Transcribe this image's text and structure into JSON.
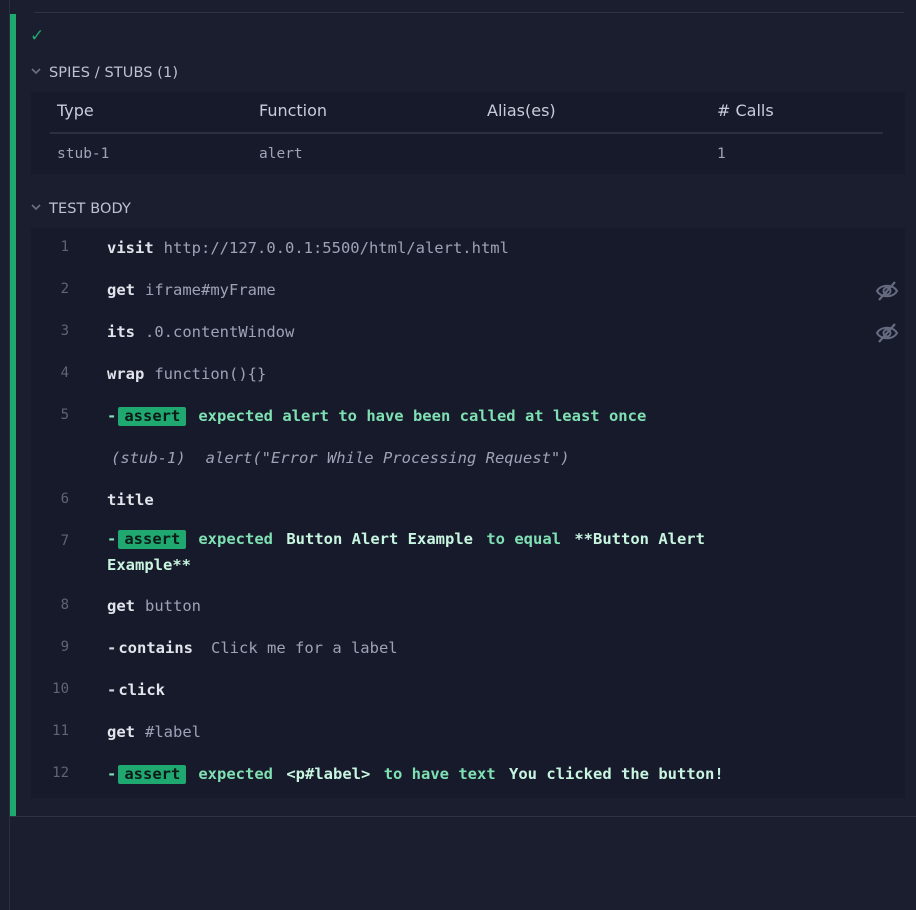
{
  "status_icon": "check-icon",
  "spies": {
    "title": "SPIES / STUBS (1)",
    "columns": [
      "Type",
      "Function",
      "Alias(es)",
      "# Calls"
    ],
    "rows": [
      {
        "type": "stub-1",
        "function": "alert",
        "aliases": "",
        "calls": "1"
      }
    ]
  },
  "test_body": {
    "title": "TEST BODY",
    "commands": [
      {
        "num": "1",
        "name": "visit",
        "arg": "http://127.0.0.1:5500/html/alert.html"
      },
      {
        "num": "2",
        "name": "get",
        "arg": "iframe#myFrame",
        "icon": "eye-slash-icon"
      },
      {
        "num": "3",
        "name": "its",
        "arg": ".0.contentWindow",
        "icon": "eye-slash-icon"
      },
      {
        "num": "4",
        "name": "wrap",
        "arg": "function(){}"
      },
      {
        "num": "5",
        "badge": "assert",
        "message": "expected alert to have been called at least once"
      },
      {
        "num": "",
        "stub_label": "(stub-1)",
        "stub_call": "alert(\"Error While Processing Request\")"
      },
      {
        "num": "6",
        "name": "title"
      },
      {
        "num": "7",
        "badge": "assert",
        "m1": "expected",
        "m2": "Button Alert Example",
        "m3": "to equal",
        "m4": "**Button Alert",
        "m5": "Example**"
      },
      {
        "num": "8",
        "name": "get",
        "arg": "button"
      },
      {
        "num": "9",
        "name": "contains",
        "arg": "Click me for a label",
        "child": true
      },
      {
        "num": "10",
        "name": "click",
        "child": true
      },
      {
        "num": "11",
        "name": "get",
        "arg": "#label"
      },
      {
        "num": "12",
        "badge": "assert",
        "m1": "expected",
        "m2": "<p#label>",
        "m3": "to have text",
        "m4": "You clicked the button!"
      }
    ]
  }
}
